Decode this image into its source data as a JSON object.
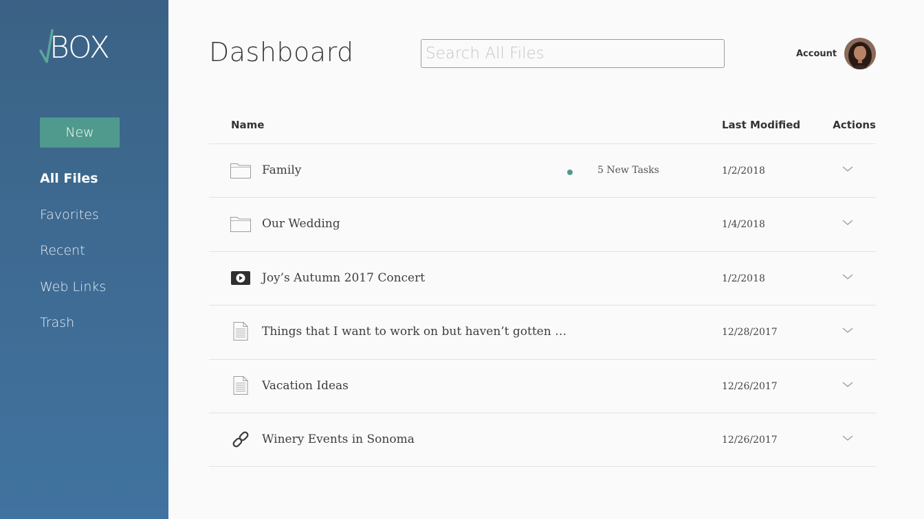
{
  "brand": {
    "name": "BOX",
    "check_color": "#5aa89a"
  },
  "sidebar": {
    "new_label": "New",
    "items": [
      {
        "label": "All Files",
        "active": true
      },
      {
        "label": "Favorites"
      },
      {
        "label": "Recent"
      },
      {
        "label": "Web Links"
      },
      {
        "label": "Trash"
      }
    ]
  },
  "header": {
    "title": "Dashboard",
    "search_placeholder": "Search All Files",
    "account_label": "Account"
  },
  "table": {
    "columns": {
      "name": "Name",
      "last_modified": "Last Modified",
      "actions": "Actions"
    },
    "rows": [
      {
        "icon": "folder-icon",
        "name": "Family",
        "tasks": "5 New Tasks",
        "modified": "1/2/2018"
      },
      {
        "icon": "folder-icon",
        "name": "Our Wedding",
        "tasks": "",
        "modified": "1/4/2018"
      },
      {
        "icon": "video-icon",
        "name": "Joy’s Autumn 2017 Concert",
        "tasks": "",
        "modified": "1/2/2018"
      },
      {
        "icon": "document-icon",
        "name": "Things that I want to work on but haven’t gotten …",
        "tasks": "",
        "modified": "12/28/2017"
      },
      {
        "icon": "document-icon",
        "name": "Vacation Ideas",
        "tasks": "",
        "modified": "12/26/2017"
      },
      {
        "icon": "link-icon",
        "name": "Winery Events in Sonoma",
        "tasks": "",
        "modified": "12/26/2017"
      }
    ]
  },
  "colors": {
    "sidebar": "#3f6a92",
    "accent": "#4f9a8c"
  }
}
